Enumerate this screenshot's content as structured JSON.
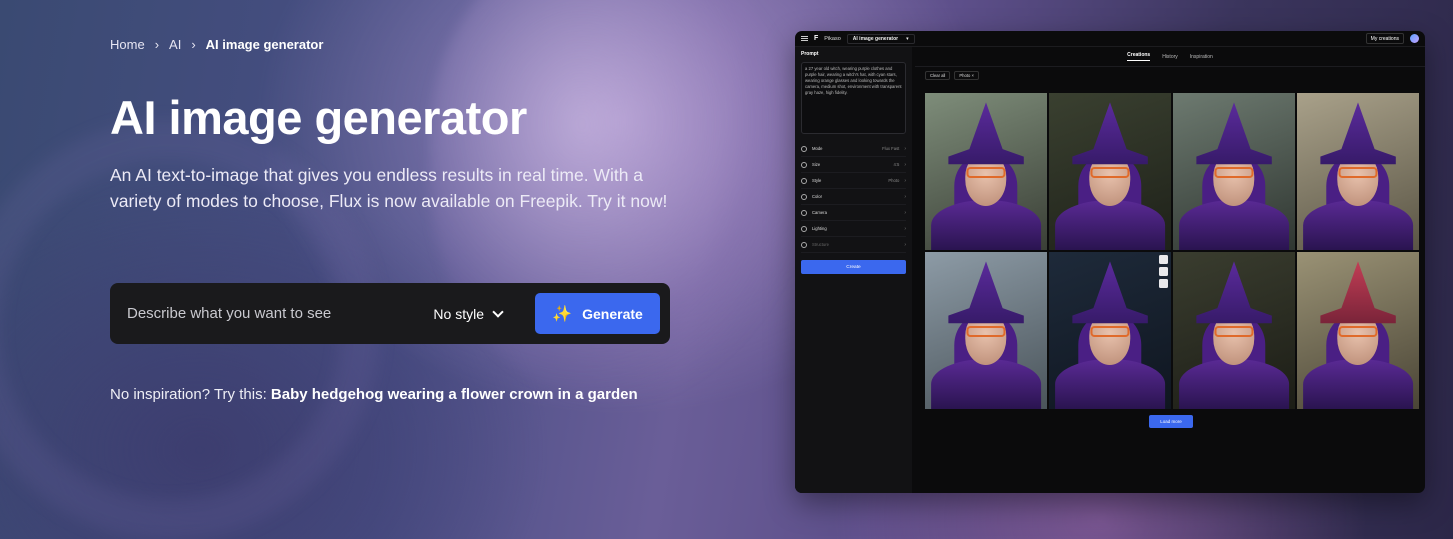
{
  "breadcrumb": {
    "items": [
      "Home",
      "AI",
      "AI image generator"
    ]
  },
  "hero": {
    "title": "AI image generator",
    "subtitle": "An AI text-to-image that gives you endless results in real time. With a variety of modes to choose, Flux is now available on Freepik. Try it now!",
    "prompt_placeholder": "Describe what you want to see",
    "style_label": "No style",
    "generate_label": "Generate",
    "inspiration_prefix": "No inspiration? Try this:",
    "inspiration_example": "Baby hedgehog wearing a flower crown in a garden"
  },
  "app": {
    "brand": "F",
    "product": "Pikaso",
    "tool": "AI image generator",
    "my_creations": "My creations",
    "prompt_label": "Prompt",
    "prompt_text": "a 27 year old witch, wearing purple clothes and purple hair, wearing a witch's hat, with cyan stars, wearing orange glasses and looking towards the camera, medium shot, environment with transparent gray haze, high fidelity.",
    "settings": [
      {
        "name": "Mode",
        "value": "Flux Fast"
      },
      {
        "name": "Size",
        "value": "4:5"
      },
      {
        "name": "Style",
        "value": "Photo"
      },
      {
        "name": "Color",
        "value": ""
      },
      {
        "name": "Camera",
        "value": ""
      },
      {
        "name": "Lighting",
        "value": ""
      },
      {
        "name": "Structure",
        "value": ""
      }
    ],
    "create_label": "Create",
    "tabs": [
      "Creations",
      "History",
      "Inspiration"
    ],
    "filters": {
      "clear_all": "Clear all",
      "chip": "Photo"
    },
    "load_more": "Load more"
  },
  "colors": {
    "accent": "#3b68ee",
    "prompt_bar_bg": "#1a1a1c"
  }
}
